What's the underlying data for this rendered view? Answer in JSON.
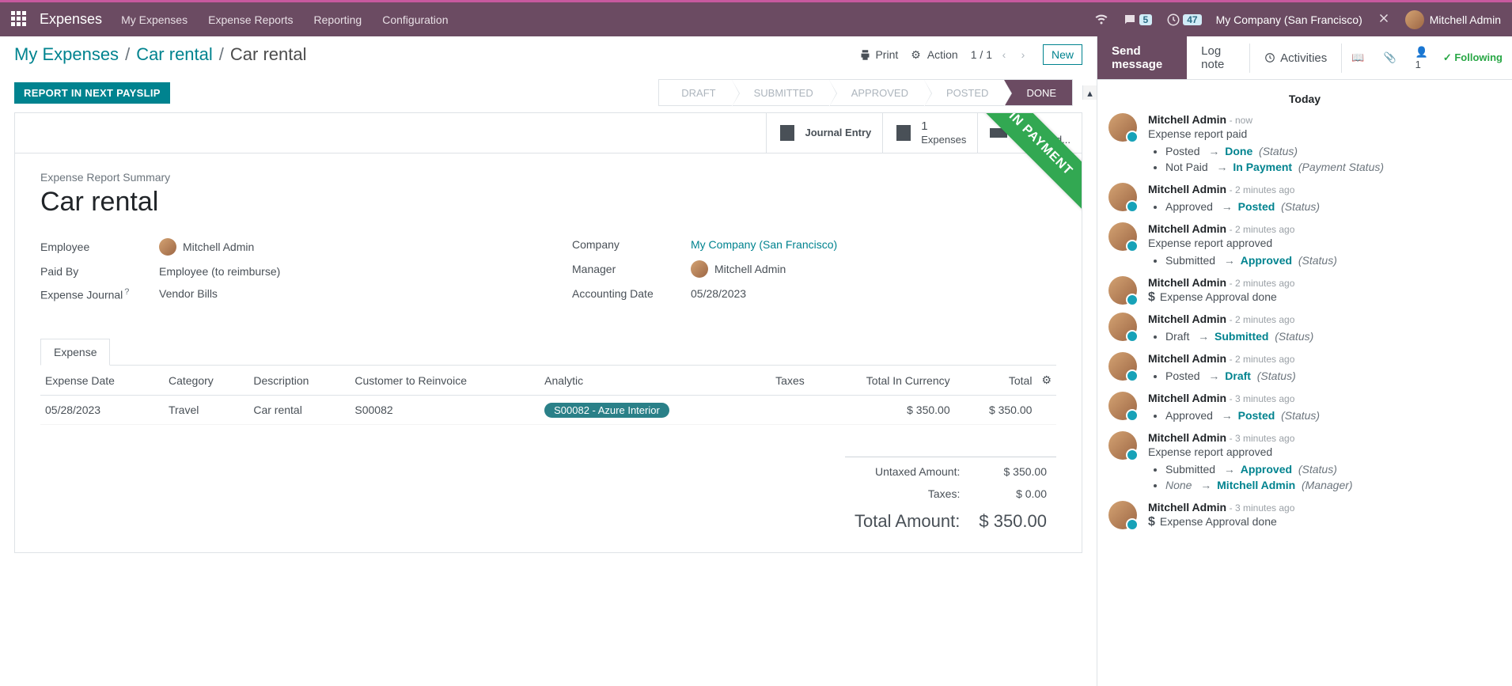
{
  "topbar": {
    "brand": "Expenses",
    "menu": [
      "My Expenses",
      "Expense Reports",
      "Reporting",
      "Configuration"
    ],
    "chat_badge": "5",
    "clock_badge": "47",
    "company": "My Company (San Francisco)",
    "user": "Mitchell Admin"
  },
  "breadcrumbs": {
    "a": "My Expenses",
    "b": "Car rental",
    "current": "Car rental"
  },
  "toolbar": {
    "print": "Print",
    "action": "Action",
    "pager": "1 / 1",
    "new": "New"
  },
  "status": {
    "report_button": "REPORT IN NEXT PAYSLIP",
    "stages": [
      "DRAFT",
      "SUBMITTED",
      "APPROVED",
      "POSTED",
      "DONE"
    ],
    "active": "DONE"
  },
  "statbtns": {
    "journal": "Journal Entry",
    "expenses_n": "1",
    "expenses_l": "Expenses",
    "sales_n": "1",
    "sales_l": "Sales Ord..."
  },
  "ribbon": "IN PAYMENT",
  "summary": {
    "subtitle": "Expense Report Summary",
    "title": "Car rental",
    "left": {
      "employee_l": "Employee",
      "employee_v": "Mitchell Admin",
      "paidby_l": "Paid By",
      "paidby_v": "Employee (to reimburse)",
      "journal_l": "Expense Journal",
      "journal_v": "Vendor Bills"
    },
    "right": {
      "company_l": "Company",
      "company_v": "My Company (San Francisco)",
      "manager_l": "Manager",
      "manager_v": "Mitchell Admin",
      "acct_l": "Accounting Date",
      "acct_v": "05/28/2023"
    }
  },
  "tabs": {
    "expense": "Expense"
  },
  "table": {
    "cols": [
      "Expense Date",
      "Category",
      "Description",
      "Customer to Reinvoice",
      "Analytic",
      "Taxes",
      "Total In Currency",
      "Total"
    ],
    "row": {
      "date": "05/28/2023",
      "cat": "Travel",
      "desc": "Car rental",
      "cust": "S00082",
      "analytic": "S00082 - Azure Interior",
      "taxes": "",
      "total_c": "$ 350.00",
      "total": "$ 350.00"
    }
  },
  "totals": {
    "untaxed_l": "Untaxed Amount:",
    "untaxed_v": "$ 350.00",
    "taxes_l": "Taxes:",
    "taxes_v": "$ 0.00",
    "total_l": "Total Amount:",
    "total_v": "$ 350.00"
  },
  "chatter": {
    "send": "Send message",
    "log": "Log note",
    "activities": "Activities",
    "followers": "1",
    "following": "Following",
    "today": "Today",
    "msgs": [
      {
        "author": "Mitchell Admin",
        "time": "now",
        "body": "Expense report paid",
        "changes": [
          {
            "from": "Posted",
            "to": "Done",
            "field": "(Status)"
          },
          {
            "from": "Not Paid",
            "to": "In Payment",
            "field": "(Payment Status)"
          }
        ]
      },
      {
        "author": "Mitchell Admin",
        "time": "2 minutes ago",
        "changes": [
          {
            "from": "Approved",
            "to": "Posted",
            "field": "(Status)"
          }
        ]
      },
      {
        "author": "Mitchell Admin",
        "time": "2 minutes ago",
        "body": "Expense report approved",
        "changes": [
          {
            "from": "Submitted",
            "to": "Approved",
            "field": "(Status)"
          }
        ]
      },
      {
        "author": "Mitchell Admin",
        "time": "2 minutes ago",
        "dollar": true,
        "body": "Expense Approval done"
      },
      {
        "author": "Mitchell Admin",
        "time": "2 minutes ago",
        "changes": [
          {
            "from": "Draft",
            "to": "Submitted",
            "field": "(Status)"
          }
        ]
      },
      {
        "author": "Mitchell Admin",
        "time": "2 minutes ago",
        "changes": [
          {
            "from": "Posted",
            "to": "Draft",
            "field": "(Status)"
          }
        ]
      },
      {
        "author": "Mitchell Admin",
        "time": "3 minutes ago",
        "changes": [
          {
            "from": "Approved",
            "to": "Posted",
            "field": "(Status)"
          }
        ]
      },
      {
        "author": "Mitchell Admin",
        "time": "3 minutes ago",
        "body": "Expense report approved",
        "changes": [
          {
            "from": "Submitted",
            "to": "Approved",
            "field": "(Status)"
          },
          {
            "from": "None",
            "fromItalic": true,
            "to": "Mitchell Admin",
            "field": "(Manager)"
          }
        ]
      },
      {
        "author": "Mitchell Admin",
        "time": "3 minutes ago",
        "dollar": true,
        "body": "Expense Approval done"
      }
    ]
  }
}
